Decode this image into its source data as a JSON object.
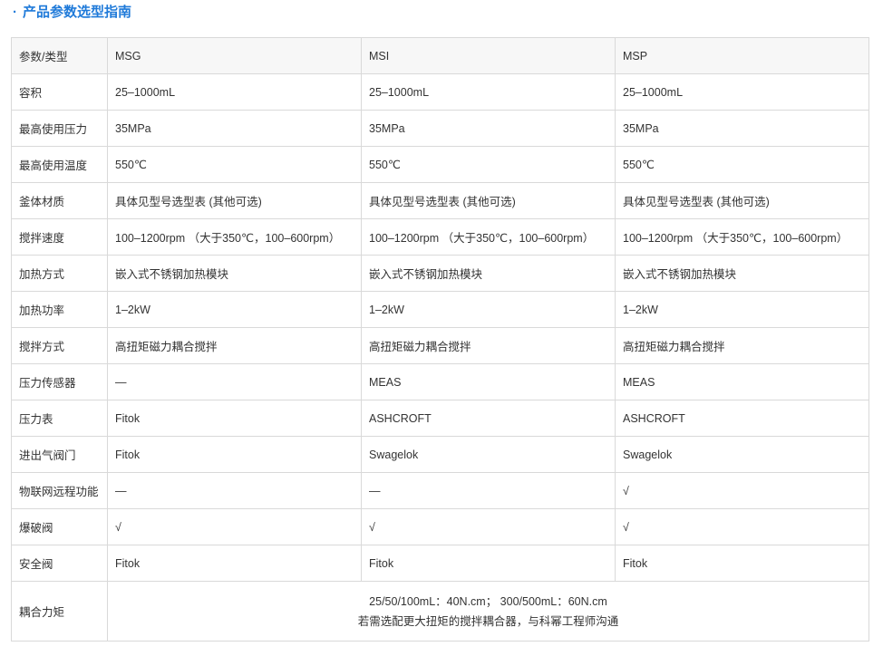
{
  "section": {
    "bullet": "·",
    "title": "产品参数选型指南"
  },
  "table": {
    "header": [
      "参数/类型",
      "MSG",
      "MSI",
      "MSP"
    ],
    "rows": [
      {
        "label": "容积",
        "values": [
          "25–1000mL",
          "25–1000mL",
          "25–1000mL"
        ]
      },
      {
        "label": "最高使用压力",
        "values": [
          "35MPa",
          "35MPa",
          "35MPa"
        ]
      },
      {
        "label": "最高使用温度",
        "values": [
          "550℃",
          "550℃",
          "550℃"
        ]
      },
      {
        "label": "釜体材质",
        "values": [
          "具体见型号选型表 (其他可选)",
          "具体见型号选型表 (其他可选)",
          "具体见型号选型表 (其他可选)"
        ]
      },
      {
        "label": "搅拌速度",
        "values": [
          "100–1200rpm （大于350℃，100–600rpm）",
          "100–1200rpm （大于350℃，100–600rpm）",
          "100–1200rpm （大于350℃，100–600rpm）"
        ]
      },
      {
        "label": "加热方式",
        "values": [
          "嵌入式不锈钢加热模块",
          "嵌入式不锈钢加热模块",
          "嵌入式不锈钢加热模块"
        ]
      },
      {
        "label": "加热功率",
        "values": [
          "1–2kW",
          "1–2kW",
          "1–2kW"
        ]
      },
      {
        "label": "搅拌方式",
        "values": [
          "高扭矩磁力耦合搅拌",
          "高扭矩磁力耦合搅拌",
          "高扭矩磁力耦合搅拌"
        ]
      },
      {
        "label": "压力传感器",
        "values": [
          "—",
          "MEAS",
          "MEAS"
        ]
      },
      {
        "label": "压力表",
        "values": [
          "Fitok",
          "ASHCROFT",
          "ASHCROFT"
        ]
      },
      {
        "label": "进出气阀门",
        "values": [
          "Fitok",
          "Swagelok",
          "Swagelok"
        ]
      },
      {
        "label": "物联网远程功能",
        "values": [
          "—",
          "—",
          "√"
        ]
      },
      {
        "label": "爆破阀",
        "values": [
          "√",
          "√",
          "√"
        ]
      },
      {
        "label": "安全阀",
        "values": [
          "Fitok",
          "Fitok",
          "Fitok"
        ]
      }
    ],
    "torque": {
      "label": "耦合力矩",
      "line1": "25/50/100mL：40N.cm； 300/500mL：60N.cm",
      "line2": "若需选配更大扭矩的搅拌耦合器，与科幂工程师沟通"
    }
  }
}
